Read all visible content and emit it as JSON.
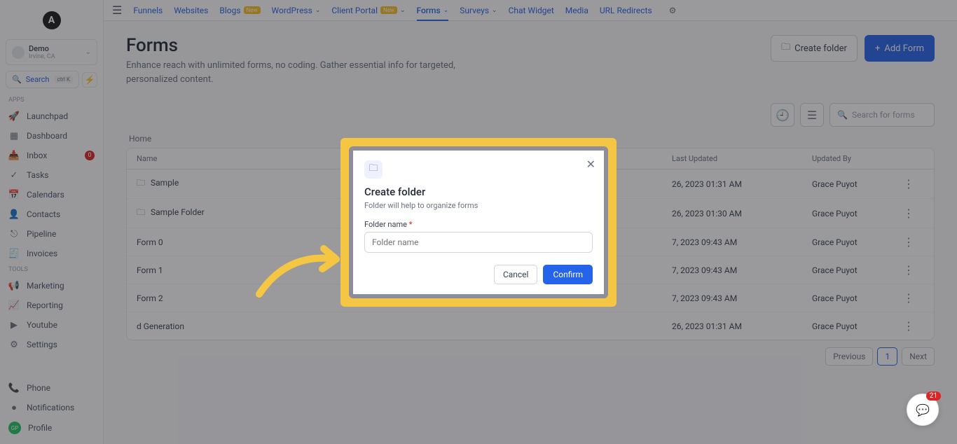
{
  "logo": "A",
  "account": {
    "name": "Demo",
    "location": "Irvine, CA"
  },
  "search": {
    "label": "Search",
    "kbd": "ctrl K"
  },
  "sections": {
    "apps": "Apps",
    "tools": "Tools"
  },
  "nav_apps": [
    {
      "icon": "🚀",
      "label": "Launchpad"
    },
    {
      "icon": "▦",
      "label": "Dashboard"
    },
    {
      "icon": "📥",
      "label": "Inbox",
      "badge": "0"
    },
    {
      "icon": "✓",
      "label": "Tasks"
    },
    {
      "icon": "📅",
      "label": "Calendars"
    },
    {
      "icon": "👤",
      "label": "Contacts"
    },
    {
      "icon": "⎋",
      "label": "Pipeline"
    },
    {
      "icon": "🧾",
      "label": "Invoices"
    }
  ],
  "nav_tools": [
    {
      "icon": "📢",
      "label": "Marketing"
    },
    {
      "icon": "📈",
      "label": "Reporting"
    },
    {
      "icon": "▶",
      "label": "Youtube"
    },
    {
      "icon": "⚙",
      "label": "Settings"
    }
  ],
  "nav_bottom": [
    {
      "icon": "📞",
      "label": "Phone"
    },
    {
      "icon": "●",
      "label": "Notifications"
    },
    {
      "icon": "GP",
      "label": "Profile"
    }
  ],
  "topnav": [
    {
      "label": "Funnels"
    },
    {
      "label": "Websites"
    },
    {
      "label": "Blogs",
      "tag": "New"
    },
    {
      "label": "WordPress",
      "chevron": true
    },
    {
      "label": "Client Portal",
      "tag": "New",
      "chevron": true
    },
    {
      "label": "Forms",
      "chevron": true,
      "active": true
    },
    {
      "label": "Surveys",
      "chevron": true
    },
    {
      "label": "Chat Widget"
    },
    {
      "label": "Media"
    },
    {
      "label": "URL Redirects"
    }
  ],
  "page": {
    "title": "Forms",
    "desc": "Enhance reach with unlimited forms, no coding. Gather essential info for targeted, personalized content.",
    "create_folder": "Create folder",
    "add_form": "Add Form",
    "search_placeholder": "Search for forms",
    "breadcrumb": "Home"
  },
  "table": {
    "cols": {
      "name": "Name",
      "date": "Last Updated",
      "by": "Updated By"
    },
    "rows": [
      {
        "name": "Sample",
        "folder": true,
        "date": "26, 2023 01:31 AM",
        "by": "Grace Puyot"
      },
      {
        "name": "Sample Folder",
        "folder": true,
        "date": "26, 2023 01:30 AM",
        "by": "Grace Puyot"
      },
      {
        "name": "Form 0",
        "date": "7, 2023 09:43 AM",
        "by": "Grace Puyot"
      },
      {
        "name": "Form 1",
        "date": "7, 2023 09:43 AM",
        "by": "Grace Puyot"
      },
      {
        "name": "Form 2",
        "date": "7, 2023 09:43 AM",
        "by": "Grace Puyot"
      },
      {
        "name": "d Generation",
        "date": "26, 2023 01:31 AM",
        "by": "Grace Puyot"
      }
    ]
  },
  "pagination": {
    "prev": "Previous",
    "page": "1",
    "next": "Next"
  },
  "modal": {
    "title": "Create folder",
    "sub": "Folder will help to organize forms",
    "field_label": "Folder name",
    "placeholder": "Folder name",
    "cancel": "Cancel",
    "confirm": "Confirm"
  },
  "chat_badge": "21"
}
